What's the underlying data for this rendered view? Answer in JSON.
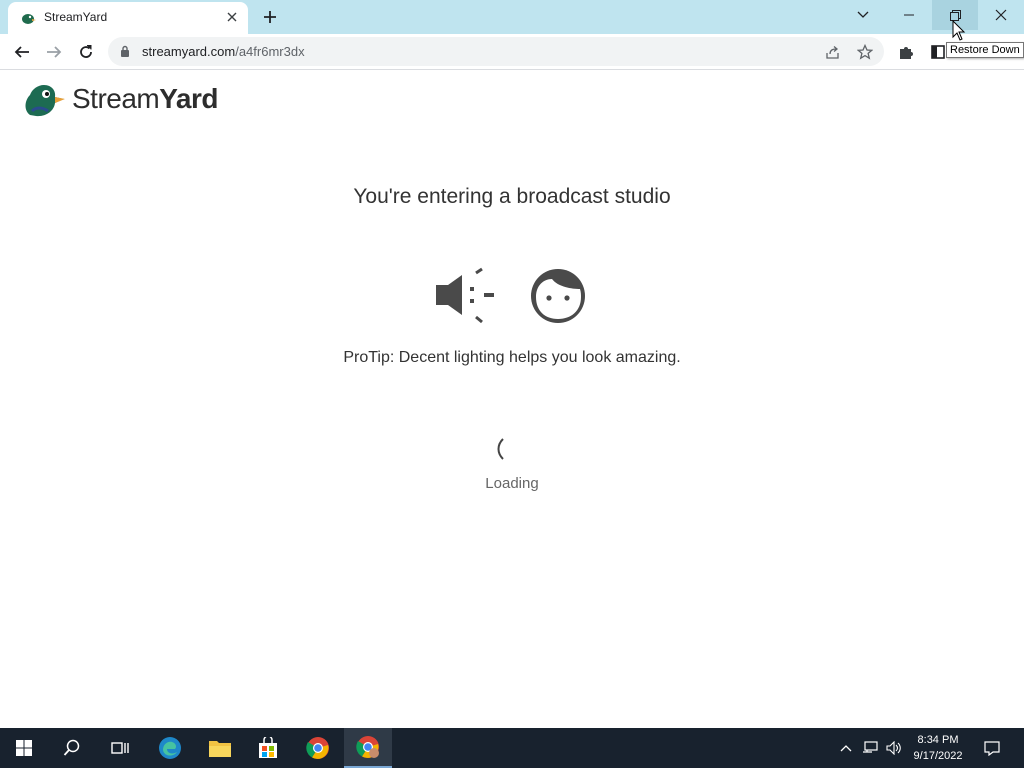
{
  "browser": {
    "tab_title": "StreamYard",
    "url_host": "streamyard.com",
    "url_path": "/a4fr6mr3dx",
    "tooltip": "Restore Down"
  },
  "page": {
    "logo_text_regular": "Stream",
    "logo_text_bold": "Yard",
    "heading": "You're entering a broadcast studio",
    "protip": "ProTip: Decent lighting helps you look amazing.",
    "loading": "Loading"
  },
  "taskbar": {
    "time": "8:34 PM",
    "date": "9/17/2022"
  },
  "colors": {
    "titlebar": "#bfe4ef",
    "taskbar": "#18222e",
    "text": "#333333"
  }
}
